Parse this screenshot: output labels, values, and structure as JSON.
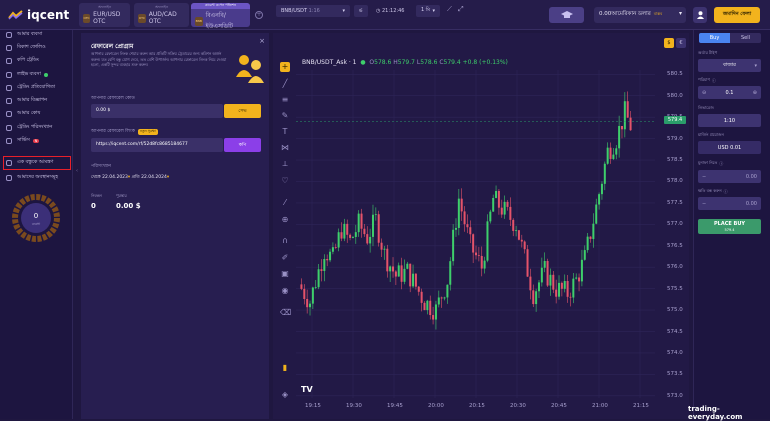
{
  "brand": {
    "name": "iqcent"
  },
  "asset_tabs": [
    {
      "caption": "অফলাইন",
      "symbol": "EUR/USD OTC",
      "icon": "OTC",
      "payout": "",
      "active": false
    },
    {
      "caption": "অফলাইন",
      "symbol": "AUD/CAD OTC",
      "icon": "OTC",
      "payout": "",
      "active": false
    },
    {
      "caption": "কারেন্ট ওপেন পজিশন",
      "symbol": "বিএনবি/ইউএসডিটি",
      "icon": "BNB",
      "payout": "",
      "active": true
    }
  ],
  "header": {
    "balance": "0.00আমেরিকান ডলার",
    "balance_sub": "বাস্তব",
    "deposit_label": "জমাদিন ফেলা"
  },
  "sidebar": {
    "items": [
      {
        "label": "আমার ব্যবসা",
        "icon": "trade-icon"
      },
      {
        "label": "বিকাশ ফোলিও",
        "icon": "portfolio-icon"
      },
      {
        "label": "কপি ট্রেডিং",
        "icon": "copy-icon"
      },
      {
        "label": "লাইভ ব্যবসা",
        "icon": "live-icon",
        "dot": true
      },
      {
        "label": "ট্রেডিং প্রতিযোগিতা",
        "icon": "trophy-icon"
      },
      {
        "label": "আমার বিজ্ঞাপন",
        "icon": "ad-icon"
      },
      {
        "label": "আমার কোষ",
        "icon": "wallet-icon"
      },
      {
        "label": "ট্রেডিং পরিসংখ্যান",
        "icon": "stats-icon"
      },
      {
        "label": "সার্ভিস",
        "icon": "service-icon",
        "badge": "N"
      },
      {
        "label": "এক বন্ধুকে আমন্ত্রণ",
        "icon": "invite-icon",
        "highlight": true
      },
      {
        "label": "আমাদের অবস্থানসমূহ",
        "icon": "location-icon"
      }
    ],
    "gauge": {
      "value": "0",
      "label": "ব্যবসা"
    }
  },
  "referral_panel": {
    "title": "রেফারেল প্রোগ্রাম",
    "description": "আপনার রেফারেল লিংক শেয়ার করুন আর প্রতিটি সক্রিয় ট্রেডারের জন্য কমিশন অর্জন করুন। যত বেশি বন্ধু যোগ দেবে, তত বেশি উপার্জন। আপনার রেফারেল লিংক নিচে দেওয়া হলো, একটি সুন্দর ব্যবহার শুরু করুন।",
    "code_label": "আপনার রেফারেল কোড",
    "code_value": "0.00 $",
    "save_label": "সেভ",
    "link_label": "আপনার রেফারেল লিংক",
    "link_chip": "নতুন সুরক্ষা",
    "link_value": "https://iqcent.com/rf/52d8fc8685184677",
    "copy_label": "কপি",
    "period_label": "পরিসংখ্যান",
    "from_label": "থেকে",
    "from_date": "22.04.2023",
    "to_label": "প্রতি",
    "to_date": "22.04.2024",
    "stat1_label": "নিবন্ধন",
    "stat1_value": "0",
    "stat2_label": "পুরস্কার",
    "stat2_value": "0.00 $"
  },
  "chart_toolbar": {
    "symbol": "BNB/USDT",
    "symbol_sub": "1:16",
    "time": "21:12:46",
    "interval": "1 মি"
  },
  "chart_legend": {
    "title": "BNB/USDT_Ask · 1",
    "o_label": "O",
    "o_value": "578.6",
    "h_label": "H",
    "h_value": "579.7",
    "l_label": "L",
    "l_value": "578.6",
    "c_label": "C",
    "c_value": "579.4",
    "change": "+0.8 (+0.13%)"
  },
  "chart_data": {
    "type": "candlestick",
    "title": "BNB/USDT_Ask · 1",
    "x_ticks": [
      "19:15",
      "19:30",
      "19:45",
      "20:00",
      "20:15",
      "20:30",
      "20:45",
      "21:00",
      "21:15"
    ],
    "y_ticks": [
      "580.5",
      "580.0",
      "579.5",
      "579.0",
      "578.5",
      "578.0",
      "577.5",
      "577.0",
      "576.5",
      "576.0",
      "575.5",
      "575.0",
      "574.5",
      "574.0",
      "573.5",
      "573.0"
    ],
    "ylim": [
      572.95,
      580.6
    ],
    "current_price": "579.4",
    "up_color": "#3ecf6b",
    "down_color": "#e5536a",
    "close_path": [
      [
        0,
        575.6
      ],
      [
        4,
        575.2
      ],
      [
        9,
        576.4
      ],
      [
        12,
        576.2
      ],
      [
        15,
        576.9
      ],
      [
        18,
        576.6
      ],
      [
        21,
        577.0
      ],
      [
        24,
        576.7
      ],
      [
        27,
        577.1
      ],
      [
        30,
        576.3
      ],
      [
        34,
        575.8
      ],
      [
        38,
        575.9
      ],
      [
        44,
        575.2
      ],
      [
        48,
        575.0
      ],
      [
        52,
        575.7
      ],
      [
        56,
        577.6
      ],
      [
        60,
        576.5
      ],
      [
        64,
        576.0
      ],
      [
        68,
        577.6
      ],
      [
        72,
        577.3
      ],
      [
        76,
        577.0
      ],
      [
        82,
        575.4
      ],
      [
        86,
        575.9
      ],
      [
        90,
        575.5
      ],
      [
        94,
        575.4
      ],
      [
        97,
        575.7
      ],
      [
        100,
        576.2
      ],
      [
        104,
        577.4
      ],
      [
        108,
        578.7
      ],
      [
        111,
        579.0
      ],
      [
        114,
        579.6
      ],
      [
        116,
        579.3
      ]
    ],
    "candle_count": 116
  },
  "mode": {
    "label_left": "$",
    "label_right": "€"
  },
  "order_panel": {
    "buy_label": "Buy",
    "sell_label": "Sell",
    "order_type_label": "অর্ডার টাইপ",
    "order_type_value": "বাজার",
    "amount_label": "পরিমাণ",
    "amount_value": "0.1",
    "leverage_label": "লিভারেজ",
    "leverage_value": "1:10",
    "margin_label": "মার্জিন প্রয়োজন",
    "margin_value": "USD 0.01",
    "tp_label": "মুনাফা নিতে",
    "tp_value": "0.00",
    "sl_label": "ক্ষতি বন্ধ করুন",
    "sl_value": "0.00",
    "place_label": "PLACE BUY",
    "place_sub": "579.4"
  },
  "watermark": "trading-everyday.com"
}
